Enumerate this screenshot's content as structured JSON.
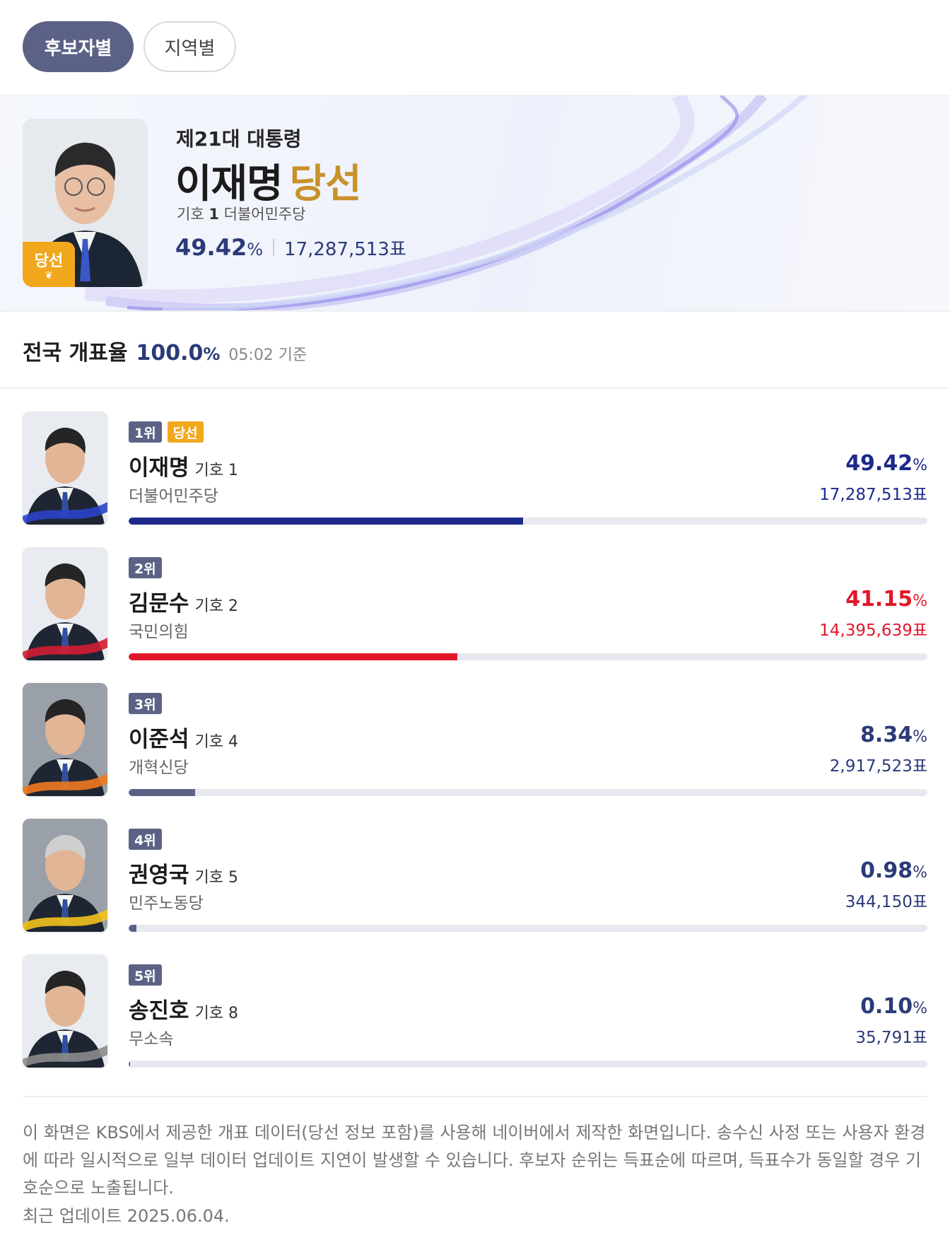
{
  "tabs": {
    "by_candidate": "후보자별",
    "by_region": "지역별"
  },
  "winner": {
    "subtitle": "제21대 대통령",
    "name": "이재명",
    "win_label": "당선",
    "symbol_label": "기호",
    "symbol_number": "1",
    "party": "더불어민주당",
    "percent": "49.42",
    "percent_unit": "%",
    "votes": "17,287,513표",
    "badge": "당선"
  },
  "count": {
    "label": "전국 개표율",
    "rate": "100.0",
    "rate_unit": "%",
    "time": "05:02 기준"
  },
  "candidates": [
    {
      "rank": "1위",
      "elected": "당선",
      "name": "이재명",
      "symbol": "기호 1",
      "party": "더불어민주당",
      "percent": "49.42",
      "percent_unit": "%",
      "votes": "17,287,513표",
      "share": 0.4942,
      "color": "#1d2a8a",
      "ribbon": "#2b44c9"
    },
    {
      "rank": "2위",
      "name": "김문수",
      "symbol": "기호 2",
      "party": "국민의힘",
      "percent": "41.15",
      "percent_unit": "%",
      "votes": "14,395,639표",
      "share": 0.4115,
      "color": "#e2172b",
      "ribbon": "#d31d33"
    },
    {
      "rank": "3위",
      "name": "이준석",
      "symbol": "기호 4",
      "party": "개혁신당",
      "percent": "8.34",
      "percent_unit": "%",
      "votes": "2,917,523표",
      "share": 0.0834,
      "color": "#5c6286",
      "ribbon": "#f07a1e"
    },
    {
      "rank": "4위",
      "name": "권영국",
      "symbol": "기호 5",
      "party": "민주노동당",
      "percent": "0.98",
      "percent_unit": "%",
      "votes": "344,150표",
      "share": 0.0098,
      "color": "#5c6286",
      "ribbon": "#f2c21a"
    },
    {
      "rank": "5위",
      "name": "송진호",
      "symbol": "기호 8",
      "party": "무소속",
      "percent": "0.10",
      "percent_unit": "%",
      "votes": "35,791표",
      "share": 0.001,
      "color": "#5c6286",
      "ribbon": "#8c8c8c"
    }
  ],
  "notice": "이 화면은 KBS에서 제공한 개표 데이터(당선 정보 포함)를 사용해 네이버에서 제작한 화면입니다. 송수신 사정 또는 사용자 환경에 따라 일시적으로 일부 데이터 업데이트 지연이 발생할 수 있습니다. 후보자 순위는 득표순에 따르며, 득표수가 동일할 경우 기호순으로 노출됩니다.",
  "updated": "최근 업데이트 2025.06.04.",
  "colors": {
    "accent": "#5c6286",
    "win": "#c8922a",
    "badge": "#f2a81d",
    "navy": "#2c3a78"
  }
}
